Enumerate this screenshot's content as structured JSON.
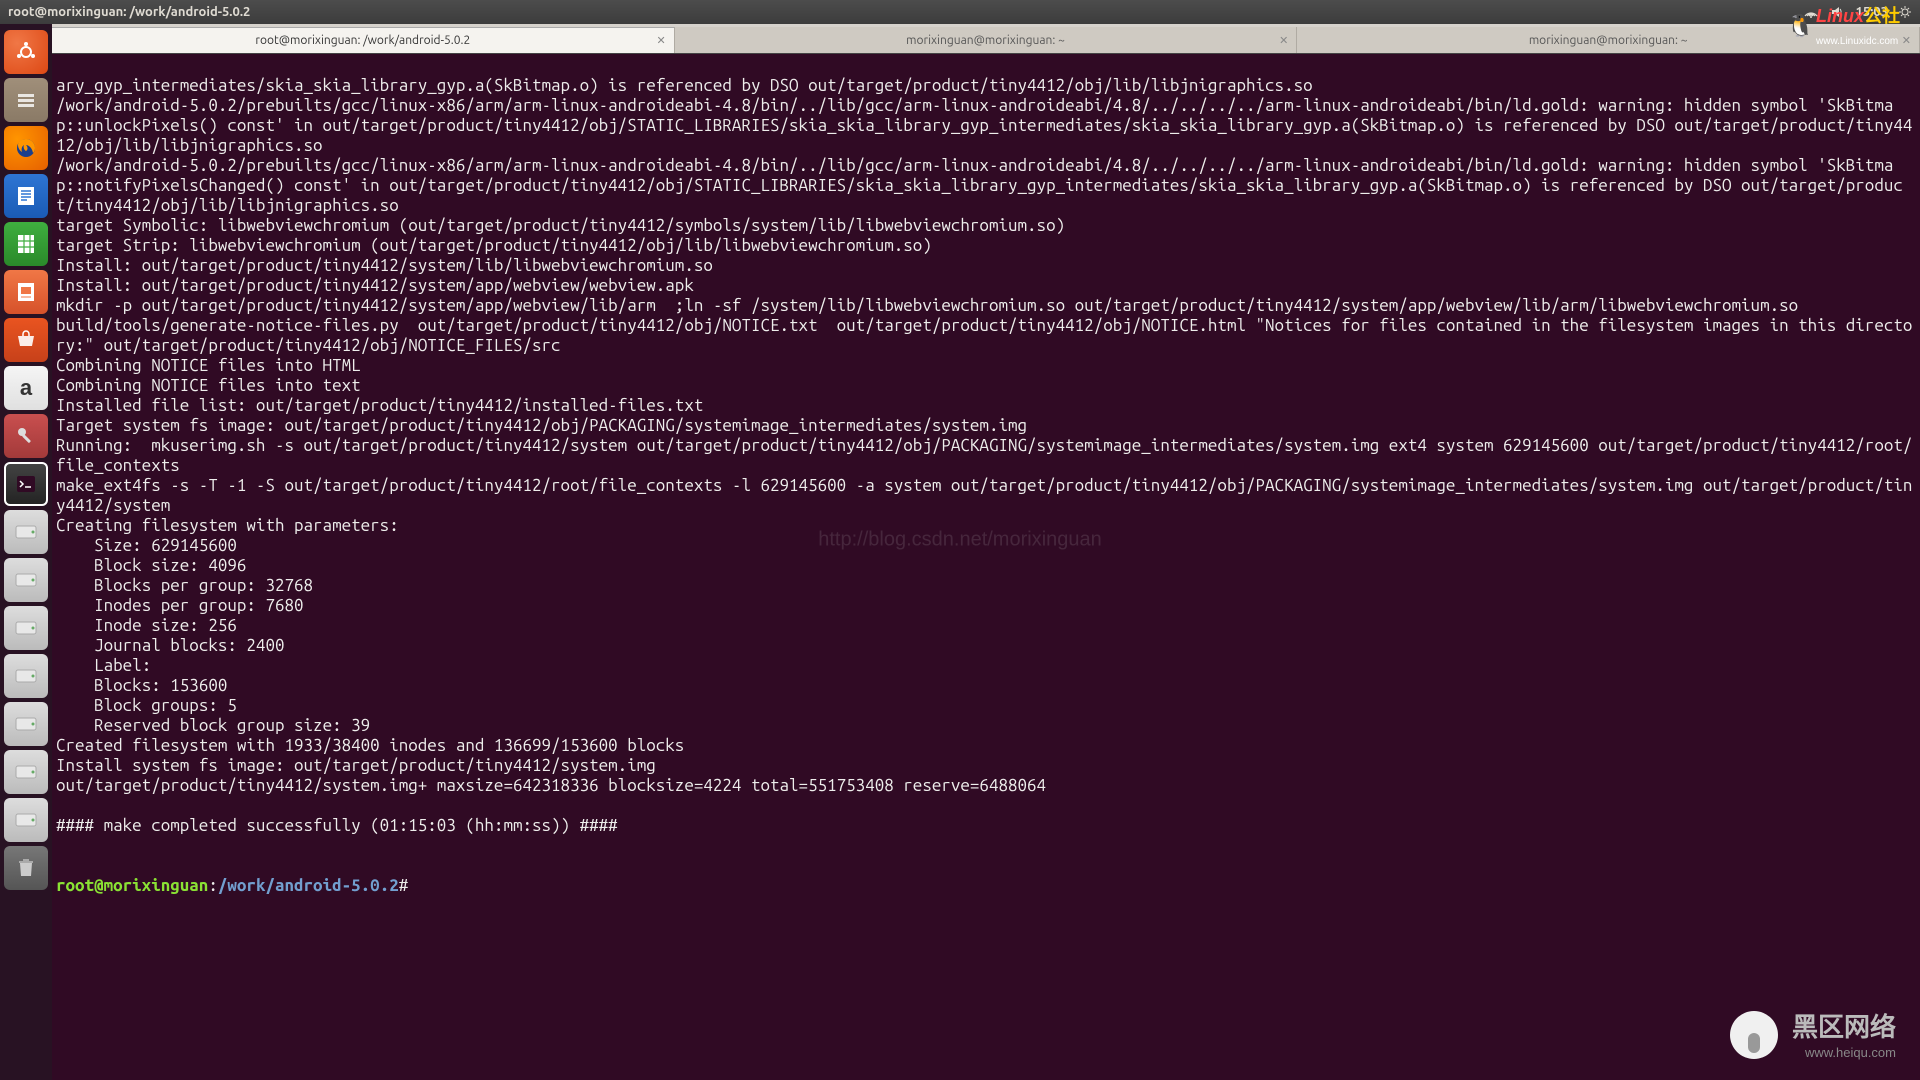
{
  "topbar": {
    "title": "root@morixinguan: /work/android-5.0.2",
    "time": "15:03"
  },
  "tabs": [
    {
      "label": "root@morixinguan: /work/android-5.0.2",
      "active": true
    },
    {
      "label": "morixinguan@morixinguan: ~",
      "active": false
    },
    {
      "label": "morixinguan@morixinguan: ~",
      "active": false
    }
  ],
  "terminal": {
    "lines": [
      "ary_gyp_intermediates/skia_skia_library_gyp.a(SkBitmap.o) is referenced by DSO out/target/product/tiny4412/obj/lib/libjnigraphics.so",
      "/work/android-5.0.2/prebuilts/gcc/linux-x86/arm/arm-linux-androideabi-4.8/bin/../lib/gcc/arm-linux-androideabi/4.8/../../../../arm-linux-androideabi/bin/ld.gold: warning: hidden symbol 'SkBitmap::unlockPixels() const' in out/target/product/tiny4412/obj/STATIC_LIBRARIES/skia_skia_library_gyp_intermediates/skia_skia_library_gyp.a(SkBitmap.o) is referenced by DSO out/target/product/tiny4412/obj/lib/libjnigraphics.so",
      "/work/android-5.0.2/prebuilts/gcc/linux-x86/arm/arm-linux-androideabi-4.8/bin/../lib/gcc/arm-linux-androideabi/4.8/../../../../arm-linux-androideabi/bin/ld.gold: warning: hidden symbol 'SkBitmap::notifyPixelsChanged() const' in out/target/product/tiny4412/obj/STATIC_LIBRARIES/skia_skia_library_gyp_intermediates/skia_skia_library_gyp.a(SkBitmap.o) is referenced by DSO out/target/product/tiny4412/obj/lib/libjnigraphics.so",
      "target Symbolic: libwebviewchromium (out/target/product/tiny4412/symbols/system/lib/libwebviewchromium.so)",
      "target Strip: libwebviewchromium (out/target/product/tiny4412/obj/lib/libwebviewchromium.so)",
      "Install: out/target/product/tiny4412/system/lib/libwebviewchromium.so",
      "Install: out/target/product/tiny4412/system/app/webview/webview.apk",
      "mkdir -p out/target/product/tiny4412/system/app/webview/lib/arm  ;ln -sf /system/lib/libwebviewchromium.so out/target/product/tiny4412/system/app/webview/lib/arm/libwebviewchromium.so",
      "build/tools/generate-notice-files.py  out/target/product/tiny4412/obj/NOTICE.txt  out/target/product/tiny4412/obj/NOTICE.html \"Notices for files contained in the filesystem images in this directory:\" out/target/product/tiny4412/obj/NOTICE_FILES/src",
      "Combining NOTICE files into HTML",
      "Combining NOTICE files into text",
      "Installed file list: out/target/product/tiny4412/installed-files.txt",
      "Target system fs image: out/target/product/tiny4412/obj/PACKAGING/systemimage_intermediates/system.img",
      "Running:  mkuserimg.sh -s out/target/product/tiny4412/system out/target/product/tiny4412/obj/PACKAGING/systemimage_intermediates/system.img ext4 system 629145600 out/target/product/tiny4412/root/file_contexts",
      "make_ext4fs -s -T -1 -S out/target/product/tiny4412/root/file_contexts -l 629145600 -a system out/target/product/tiny4412/obj/PACKAGING/systemimage_intermediates/system.img out/target/product/tiny4412/system",
      "Creating filesystem with parameters:",
      "    Size: 629145600",
      "    Block size: 4096",
      "    Blocks per group: 32768",
      "    Inodes per group: 7680",
      "    Inode size: 256",
      "    Journal blocks: 2400",
      "    Label: ",
      "    Blocks: 153600",
      "    Block groups: 5",
      "    Reserved block group size: 39",
      "Created filesystem with 1933/38400 inodes and 136699/153600 blocks",
      "Install system fs image: out/target/product/tiny4412/system.img",
      "out/target/product/tiny4412/system.img+ maxsize=642318336 blocksize=4224 total=551753408 reserve=6488064",
      "",
      "#### make completed successfully (01:15:03 (hh:mm:ss)) ####",
      ""
    ],
    "prompt_user": "root@morixinguan",
    "prompt_path": "/work/android-5.0.2",
    "prompt_symbol": "#"
  },
  "watermarks": {
    "top_right_label": "Linux",
    "top_right_sub": "www.Linuxidc.com",
    "bottom_right_label": "黑区网络",
    "bottom_right_sub": "www.heiqu.com",
    "center": "http://blog.csdn.net/morixinguan"
  },
  "launcher": {
    "items": [
      "ubuntu-dash",
      "files",
      "firefox",
      "writer",
      "calc",
      "impress",
      "software-center",
      "amazon",
      "settings",
      "terminal",
      "drive",
      "drive",
      "drive",
      "drive",
      "drive",
      "drive",
      "drive",
      "trash"
    ]
  }
}
